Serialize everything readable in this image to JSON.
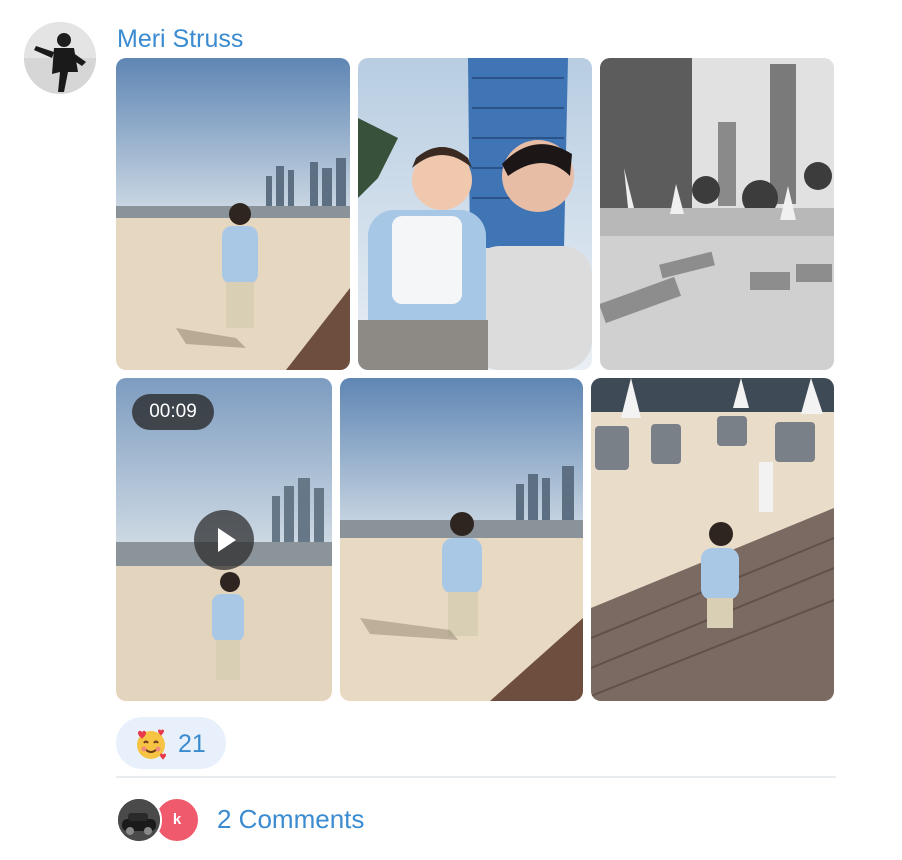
{
  "post": {
    "author_name": "Meri Struss",
    "media": [
      {
        "kind": "photo",
        "subject": "toddler walking on beach with city skyline"
      },
      {
        "kind": "photo",
        "subject": "mother holding toddler near tower"
      },
      {
        "kind": "photo",
        "subject": "black and white beach loungers"
      },
      {
        "kind": "video",
        "duration": "00:09",
        "subject": "toddler on beach"
      },
      {
        "kind": "photo",
        "subject": "toddler walking on sand with skyline"
      },
      {
        "kind": "photo",
        "subject": "toddler walking on wooden deck"
      }
    ],
    "reaction": {
      "emoji": "smiling-face-with-hearts",
      "count": "21"
    },
    "comments": {
      "label": "2 Comments",
      "commenter_initial": "k"
    }
  },
  "colors": {
    "accent": "#3a8bd0",
    "reaction_bg": "#e8f1fb"
  }
}
